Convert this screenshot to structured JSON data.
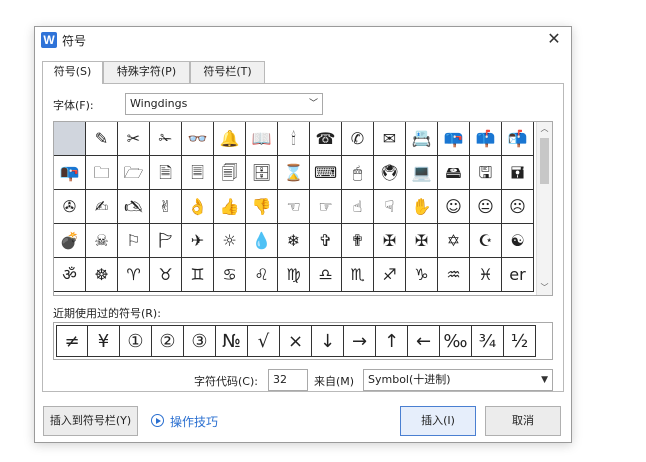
{
  "dialog": {
    "title": "符号",
    "app_icon_letter": "W",
    "close_glyph": "✕"
  },
  "tabs": [
    {
      "label": "符号(S)",
      "active": true
    },
    {
      "label": "特殊字符(P)",
      "active": false
    },
    {
      "label": "符号栏(T)",
      "active": false
    }
  ],
  "font": {
    "label": "字体(F):",
    "value": "Wingdings"
  },
  "symbols": [
    [
      "",
      "✎",
      "✂",
      "✁",
      "👓",
      "🔔",
      "📖",
      "🕯",
      "☎",
      "✆",
      "✉",
      "📇",
      "📪",
      "📫",
      "📬"
    ],
    [
      "📭",
      "🗀",
      "🗁",
      "🗎",
      "🗏",
      "🗐",
      "🗄",
      "⌛",
      "⌨",
      "🖱",
      "🖲",
      "💻",
      "🖴",
      "🖫",
      "🖬"
    ],
    [
      "✇",
      "✍",
      "🖎",
      "✌",
      "👌",
      "👍",
      "👎",
      "☜",
      "☞",
      "☝",
      "☟",
      "✋",
      "☺",
      "😐",
      "☹"
    ],
    [
      "💣",
      "☠",
      "⚐",
      "🏱",
      "✈",
      "☼",
      "💧",
      "❄",
      "✞",
      "✟",
      "✠",
      "✠",
      "✡",
      "☪",
      "☯"
    ],
    [
      "ॐ",
      "☸",
      "♈",
      "♉",
      "♊",
      "♋",
      "♌",
      "♍",
      "♎",
      "♏",
      "♐",
      "♑",
      "♒",
      "♓",
      "er"
    ]
  ],
  "selected_cell": [
    0,
    0
  ],
  "recent": {
    "label": "近期使用过的符号(R):",
    "items": [
      "≠",
      "¥",
      "①",
      "②",
      "③",
      "№",
      "√",
      "×",
      "↓",
      "→",
      "↑",
      "←",
      "‰",
      "¾",
      "½"
    ]
  },
  "char_code": {
    "label": "字符代码(C):",
    "value": "32",
    "from_label": "来自(M)",
    "from_value": "Symbol(十进制)"
  },
  "buttons": {
    "insert_to_bar": "插入到符号栏(Y)",
    "tips": "操作技巧",
    "insert": "插入(I)",
    "cancel": "取消"
  }
}
